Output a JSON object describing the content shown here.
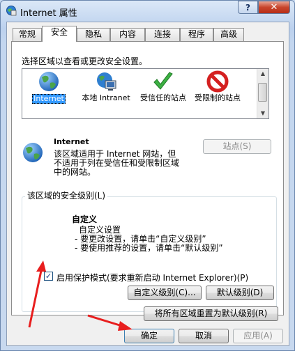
{
  "window": {
    "title": "Internet 属性",
    "help_glyph": "?",
    "close_glyph": "✕"
  },
  "tabs": [
    {
      "label": "常规"
    },
    {
      "label": "安全"
    },
    {
      "label": "隐私"
    },
    {
      "label": "内容"
    },
    {
      "label": "连接"
    },
    {
      "label": "程序"
    },
    {
      "label": "高级"
    }
  ],
  "active_tab": "安全",
  "security": {
    "instruction": "选择区域以查看或更改安全设置。",
    "zones": [
      {
        "label": "Internet",
        "icon": "globe-icon",
        "selected": true
      },
      {
        "label": "本地 Intranet",
        "icon": "intranet-icon",
        "selected": false
      },
      {
        "label": "受信任的站点",
        "icon": "checkmark-icon",
        "selected": false
      },
      {
        "label": "受限制的站点",
        "icon": "restricted-icon",
        "selected": false
      }
    ],
    "zone_name": "Internet",
    "zone_description": "该区域适用于 Internet 网站，但不适用于列在受信任和受限制区域中的网站。",
    "sites_button": "站点(S)",
    "level_group_label": "该区域的安全级别(L)",
    "level_title": "自定义",
    "level_desc_1": "自定义设置",
    "level_desc_2": "- 要更改设置，请单击“自定义级别”",
    "level_desc_3": "- 要使用推荐的设置，请单击“默认级别”",
    "protected_mode_checked": true,
    "protected_mode_label": "启用保护模式(要求重新启动 Internet Explorer)(P)",
    "custom_level_button": "自定义级别(C)...",
    "default_level_button": "默认级别(D)",
    "reset_all_button": "将所有区域重置为默认级别(R)"
  },
  "footer": {
    "ok": "确定",
    "cancel": "取消",
    "apply": "应用(A)"
  },
  "colors": {
    "selection": "#3399ff",
    "annotation_arrow": "#e81e1e",
    "title_bar": "#c3d6ef"
  }
}
